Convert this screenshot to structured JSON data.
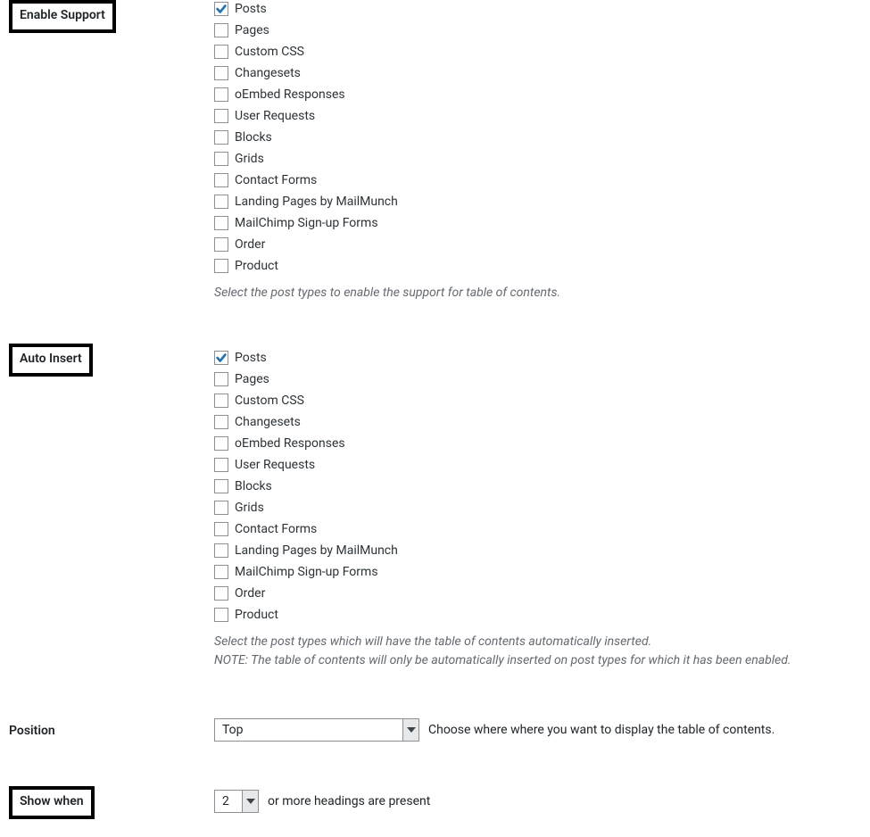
{
  "sections": {
    "enable_support": {
      "label": "Enable Support",
      "highlighted": true,
      "items": [
        {
          "label": "Posts",
          "checked": true
        },
        {
          "label": "Pages",
          "checked": false
        },
        {
          "label": "Custom CSS",
          "checked": false
        },
        {
          "label": "Changesets",
          "checked": false
        },
        {
          "label": "oEmbed Responses",
          "checked": false
        },
        {
          "label": "User Requests",
          "checked": false
        },
        {
          "label": "Blocks",
          "checked": false
        },
        {
          "label": "Grids",
          "checked": false
        },
        {
          "label": "Contact Forms",
          "checked": false
        },
        {
          "label": "Landing Pages by MailMunch",
          "checked": false
        },
        {
          "label": "MailChimp Sign-up Forms",
          "checked": false
        },
        {
          "label": "Order",
          "checked": false
        },
        {
          "label": "Product",
          "checked": false
        }
      ],
      "description": "Select the post types to enable the support for table of contents."
    },
    "auto_insert": {
      "label": "Auto Insert",
      "highlighted": true,
      "items": [
        {
          "label": "Posts",
          "checked": true
        },
        {
          "label": "Pages",
          "checked": false
        },
        {
          "label": "Custom CSS",
          "checked": false
        },
        {
          "label": "Changesets",
          "checked": false
        },
        {
          "label": "oEmbed Responses",
          "checked": false
        },
        {
          "label": "User Requests",
          "checked": false
        },
        {
          "label": "Blocks",
          "checked": false
        },
        {
          "label": "Grids",
          "checked": false
        },
        {
          "label": "Contact Forms",
          "checked": false
        },
        {
          "label": "Landing Pages by MailMunch",
          "checked": false
        },
        {
          "label": "MailChimp Sign-up Forms",
          "checked": false
        },
        {
          "label": "Order",
          "checked": false
        },
        {
          "label": "Product",
          "checked": false
        }
      ],
      "description": "Select the post types which will have the table of contents automatically inserted.",
      "note": "NOTE: The table of contents will only be automatically inserted on post types for which it has been enabled."
    },
    "position": {
      "label": "Position",
      "highlighted": false,
      "selected": "Top",
      "hint": "Choose where where you want to display the table of contents."
    },
    "show_when": {
      "label": "Show when",
      "highlighted": true,
      "selected": "2",
      "hint": "or more headings are present"
    }
  }
}
